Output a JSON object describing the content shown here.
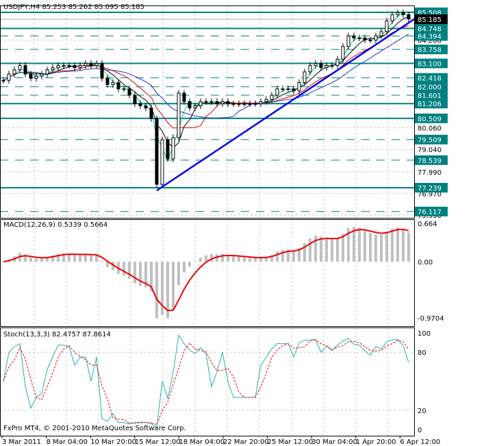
{
  "chart_data": {
    "type": "candlestick",
    "symbol_header": "USDJPY,H4  85.253 85.262 85.095 85.185",
    "current_price": "85.185",
    "closes": [
      82.3,
      82.6,
      82.8,
      83.0,
      82.6,
      82.4,
      82.5,
      82.6,
      82.8,
      82.9,
      83.0,
      83.0,
      83.0,
      82.9,
      83.0,
      83.1,
      83.0,
      83.1,
      82.4,
      82.1,
      82.2,
      81.9,
      81.9,
      81.6,
      81.2,
      81.1,
      81.0,
      80.5,
      77.4,
      79.5,
      78.6,
      79.6,
      81.7,
      81.3,
      81.0,
      81.1,
      81.3,
      81.3,
      81.3,
      81.2,
      81.3,
      81.2,
      81.2,
      81.2,
      81.2,
      81.2,
      81.2,
      81.3,
      81.4,
      81.6,
      81.9,
      81.9,
      81.9,
      81.8,
      82.2,
      82.7,
      83.0,
      83.1,
      82.9,
      83.0,
      83.0,
      83.3,
      83.9,
      84.4,
      84.3,
      84.3,
      84.2,
      84.2,
      84.4,
      84.6,
      85.1,
      85.4,
      85.5,
      85.4,
      85.2
    ],
    "ylim": [
      75.95,
      85.9
    ],
    "y_ticks": [
      "84.200",
      "80.060",
      "79.040",
      "77.990",
      "76.970",
      "75.950"
    ],
    "levels_solid": [
      "85.508",
      "84.748",
      "83.100",
      "81.206",
      "80.509",
      "77.239"
    ],
    "levels_dashed": [
      "84.394",
      "83.758",
      "82.418",
      "82.000",
      "81.601",
      "79.509",
      "78.539",
      "76.117"
    ],
    "moving_averages": [
      {
        "period": 5,
        "color": "#00dd88"
      },
      {
        "period": 10,
        "color": "#000000"
      },
      {
        "period": 18,
        "color": "#dd0000"
      },
      {
        "period": 30,
        "color": "#2233cc"
      }
    ],
    "trendline": {
      "from": 77.239,
      "to": 85.508,
      "color": "#0000ee"
    },
    "x_ticks": [
      "3 Mar 2011",
      "8 Mar 04:00",
      "10 Mar 20:00",
      "15 Mar 12:00",
      "18 Mar 04:00",
      "22 Mar 20:00",
      "25 Mar 12:00",
      "30 Mar 04:00",
      "1 Apr 20:00",
      "6 Apr 12:00"
    ],
    "macd": {
      "label": "MACD(12,26,9) 0.5339 0.5664",
      "ylim": [
        -0.9704,
        0.664
      ],
      "ticks": [
        "0.664",
        "0.00",
        "-0.9704"
      ],
      "histogram_color": "#c0c0c0",
      "signal_color": "#ee0000"
    },
    "stochastic": {
      "label": "Stoch(13,3,3) 82.4757 87.8614",
      "ylim": [
        0,
        100
      ],
      "ticks": [
        "100",
        "80",
        "20",
        "0"
      ],
      "main_color": "#20b2aa",
      "signal_color": "#ee0000"
    },
    "level_color": "#008080"
  },
  "footer": {
    "copyright": "FxPro MT4, © 2001-2010 MetaQuotes Software Corp."
  }
}
